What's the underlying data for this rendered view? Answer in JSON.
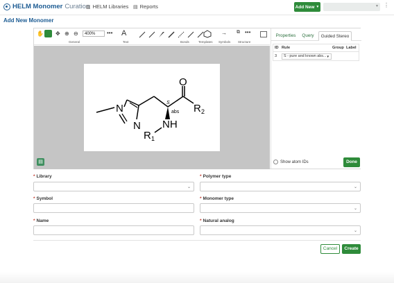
{
  "nav": {
    "app_name": "HELM Monomer",
    "app_sub": "Curation",
    "libraries_label": "HELM Libraries",
    "reports_label": "Reports",
    "add_new_label": "Add New",
    "more_icon": "more-dots-icon"
  },
  "page": {
    "title": "Add New Monomer"
  },
  "toolbar": {
    "zoom_value": "400%",
    "groups": [
      "General",
      "Text",
      "Bonds",
      "Templates",
      "Symbols",
      "Structure"
    ]
  },
  "molecule": {
    "methyl": "—",
    "n_ring1": "N",
    "n_ring2": "N",
    "nh": "NH",
    "oxygen": "O",
    "r1": "R",
    "r1_sub": "1",
    "r2": "R",
    "r2_sub": "2",
    "stereo": "S",
    "abs": "abs"
  },
  "panel": {
    "tabs": [
      "Properties",
      "Query",
      "Guided Stereo"
    ],
    "active_tab": "Guided Stereo",
    "table_headers": [
      "ID",
      "Rule",
      "Group",
      "Label"
    ],
    "rows": [
      {
        "id": "3",
        "rule": "S - pure and known abs...",
        "group": "",
        "label": ""
      }
    ],
    "show_atom_ids": "Show atom IDs",
    "done_label": "Done"
  },
  "form": {
    "library_label": "Library",
    "polymer_type_label": "Polymer type",
    "symbol_label": "Symbol",
    "monomer_type_label": "Monomer type",
    "name_label": "Name",
    "natural_analog_label": "Natural analog",
    "library_value": "",
    "polymer_type_value": "",
    "symbol_value": "",
    "monomer_type_value": "",
    "name_value": "",
    "natural_analog_value": ""
  },
  "actions": {
    "cancel_label": "Cancel",
    "create_label": "Create"
  },
  "colors": {
    "brand": "#1d5c93",
    "accent": "#2e8b3a",
    "required": "#c0392b",
    "canvas_bg": "#c5c5c5"
  }
}
